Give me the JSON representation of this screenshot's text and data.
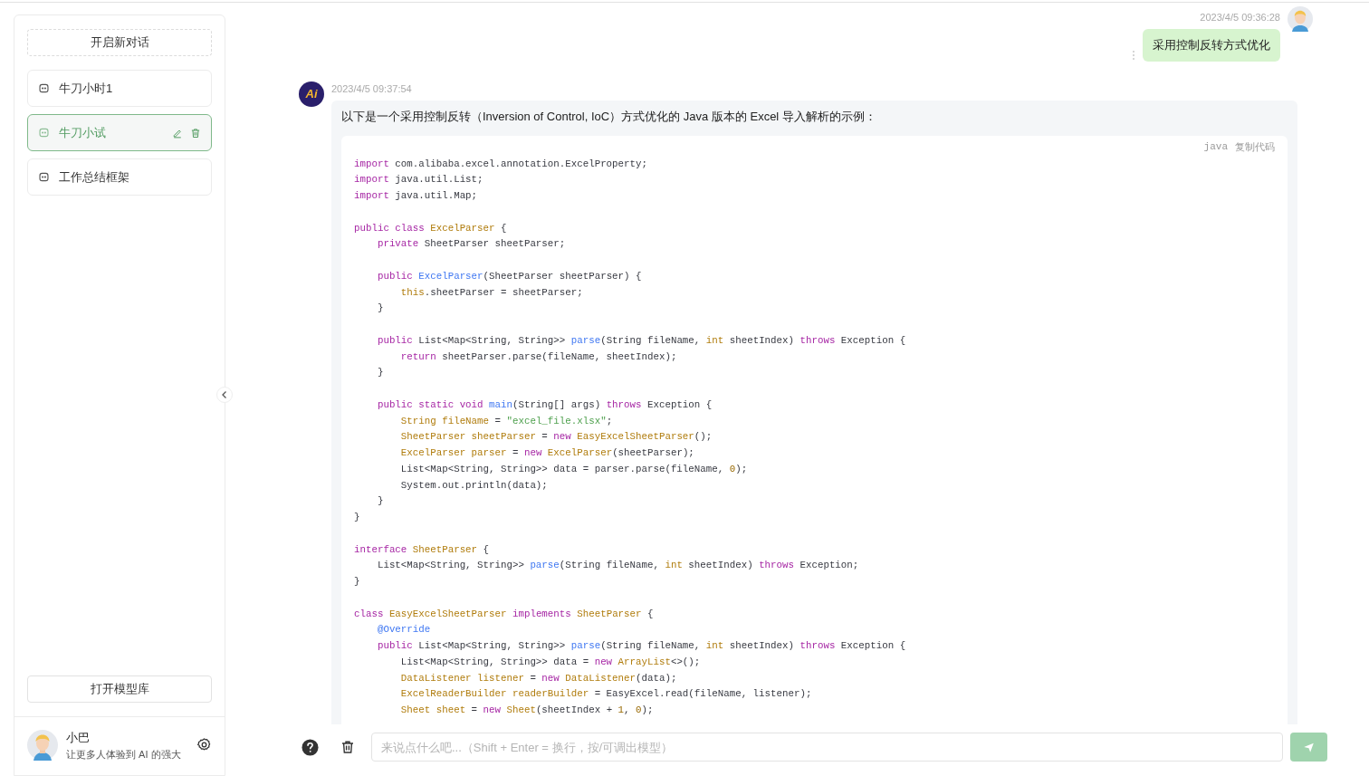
{
  "sidebar": {
    "new_chat_button": "开启新对话",
    "conversations": [
      {
        "title": "牛刀小时1",
        "selected": false
      },
      {
        "title": "牛刀小试",
        "selected": true
      },
      {
        "title": "工作总结框架",
        "selected": false
      }
    ],
    "model_library_button": "打开模型库",
    "user": {
      "name": "小巴",
      "tagline": "让更多人体验到 AI 的强大"
    }
  },
  "messages": [
    {
      "kind": "user",
      "time": "2023/4/5 09:36:28",
      "text": "采用控制反转方式优化"
    },
    {
      "kind": "ai",
      "avatar_label": "Ai",
      "time": "2023/4/5 09:37:54",
      "text": "以下是一个采用控制反转（Inversion of Control, IoC）方式优化的 Java 版本的 Excel 导入解析的示例：",
      "code": {
        "language": "java",
        "copy_label": "复制代码",
        "blocks": [
          [
            [
              {
                "kind": "kw",
                "text": "import"
              },
              " com.alibaba.excel.annotation.ExcelProperty;"
            ],
            [
              {
                "kind": "kw",
                "text": "import"
              },
              " java.util.List;"
            ],
            [
              {
                "kind": "kw",
                "text": "import"
              },
              " java.util.Map;"
            ]
          ],
          [
            [
              {
                "kind": "kw",
                "text": "public class "
              },
              {
                "kind": "type",
                "text": "ExcelParser"
              },
              " {"
            ],
            [
              {
                "kind": "kw",
                "text": "    private"
              },
              " SheetParser sheetParser;"
            ]
          ],
          [
            [
              {
                "kind": "kw",
                "text": "    public "
              },
              {
                "kind": "fn",
                "text": "ExcelParser"
              },
              "(SheetParser sheetParser) {"
            ],
            [
              {
                "kind": "type",
                "text": "        this"
              },
              ".sheetParser = sheetParser;"
            ],
            [
              "    }"
            ]
          ],
          [
            [
              {
                "kind": "kw",
                "text": "    public"
              },
              " List<Map<String, String>> ",
              {
                "kind": "fn",
                "text": "parse"
              },
              "(String fileName, ",
              {
                "kind": "type",
                "text": "int"
              },
              " sheetIndex) ",
              {
                "kind": "kw",
                "text": "throws"
              },
              " Exception {"
            ],
            [
              {
                "kind": "kw",
                "text": "        return"
              },
              " sheetParser.parse(fileName, sheetIndex);"
            ],
            [
              "    }"
            ]
          ],
          [
            [
              {
                "kind": "kw",
                "text": "    public static void "
              },
              {
                "kind": "fn",
                "text": "main"
              },
              "(String[] args) ",
              {
                "kind": "kw",
                "text": "throws"
              },
              " Exception {"
            ],
            [
              {
                "kind": "type",
                "text": "        String fileName"
              },
              " = ",
              {
                "kind": "str",
                "text": "\"excel_file.xlsx\""
              },
              ";"
            ],
            [
              {
                "kind": "type",
                "text": "        SheetParser sheetParser"
              },
              " = ",
              {
                "kind": "kw",
                "text": "new "
              },
              {
                "kind": "type",
                "text": "EasyExcelSheetParser"
              },
              "();"
            ],
            [
              {
                "kind": "type",
                "text": "        ExcelParser parser"
              },
              " = ",
              {
                "kind": "kw",
                "text": "new "
              },
              {
                "kind": "type",
                "text": "ExcelParser"
              },
              "(sheetParser);"
            ],
            [
              "        List<Map<String, String>> data = parser.parse(fileName, ",
              {
                "kind": "num",
                "text": "0"
              },
              ");"
            ],
            [
              "        System.out.println(data);"
            ],
            [
              "    }"
            ],
            [
              "}"
            ]
          ],
          [
            [
              {
                "kind": "kw",
                "text": "interface "
              },
              {
                "kind": "type",
                "text": "SheetParser"
              },
              " {"
            ],
            [
              "    List<Map<String, String>> ",
              {
                "kind": "fn",
                "text": "parse"
              },
              "(String fileName, ",
              {
                "kind": "type",
                "text": "int"
              },
              " sheetIndex) ",
              {
                "kind": "kw",
                "text": "throws"
              },
              " Exception;"
            ],
            [
              "}"
            ]
          ],
          [
            [
              {
                "kind": "kw",
                "text": "class "
              },
              {
                "kind": "type",
                "text": "EasyExcelSheetParser "
              },
              {
                "kind": "kw",
                "text": "implements "
              },
              {
                "kind": "type",
                "text": "SheetParser"
              },
              " {"
            ],
            [
              {
                "kind": "ann",
                "text": "    @Override"
              }
            ],
            [
              {
                "kind": "kw",
                "text": "    public"
              },
              " List<Map<String, String>> ",
              {
                "kind": "fn",
                "text": "parse"
              },
              "(String fileName, ",
              {
                "kind": "type",
                "text": "int"
              },
              " sheetIndex) ",
              {
                "kind": "kw",
                "text": "throws"
              },
              " Exception {"
            ],
            [
              "        List<Map<String, String>> data = ",
              {
                "kind": "kw",
                "text": "new "
              },
              {
                "kind": "type",
                "text": "ArrayList"
              },
              "<>();"
            ],
            [
              {
                "kind": "type",
                "text": "        DataListener listener"
              },
              " = ",
              {
                "kind": "kw",
                "text": "new "
              },
              {
                "kind": "type",
                "text": "DataListener"
              },
              "(data);"
            ],
            [
              {
                "kind": "type",
                "text": "        ExcelReaderBuilder readerBuilder"
              },
              " = EasyExcel.read(fileName, listener);"
            ],
            [
              {
                "kind": "type",
                "text": "        Sheet sheet"
              },
              " = ",
              {
                "kind": "kw",
                "text": "new "
              },
              {
                "kind": "type",
                "text": "Sheet"
              },
              "(sheetIndex + ",
              {
                "kind": "num",
                "text": "1"
              },
              ", ",
              {
                "kind": "num",
                "text": "0"
              },
              ");"
            ]
          ]
        ]
      }
    }
  ],
  "composer": {
    "placeholder": "来说点什么吧...（Shift + Enter = 换行，按/可调出模型）"
  }
}
